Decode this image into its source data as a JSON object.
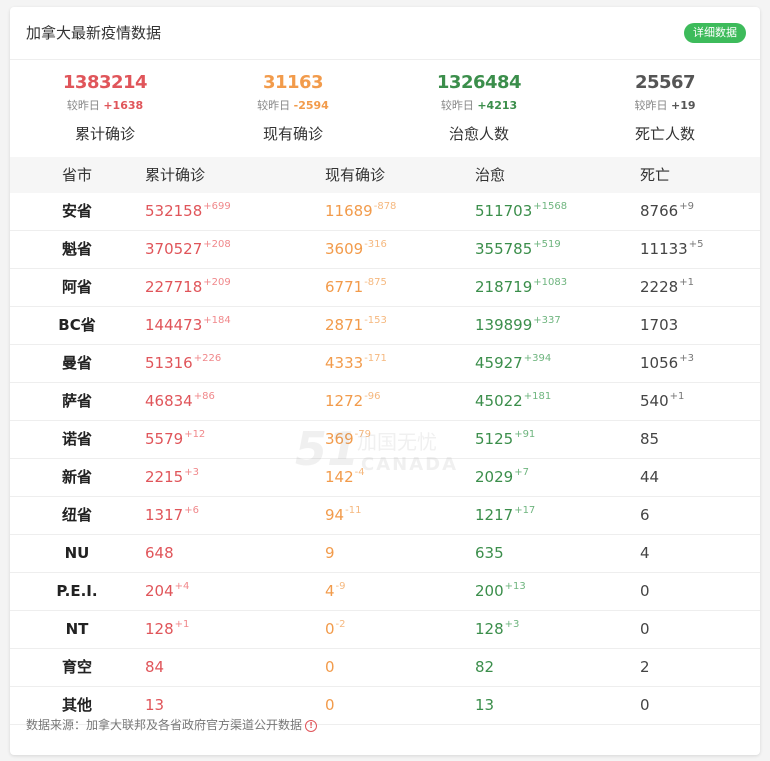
{
  "header": {
    "title": "加拿大最新疫情数据",
    "detail_label": "详细数据"
  },
  "summary": [
    {
      "value": "1383214",
      "delta_prefix": "较昨日",
      "delta": "+1638",
      "label": "累计确诊",
      "color": "#e0555a"
    },
    {
      "value": "31163",
      "delta_prefix": "较昨日",
      "delta": "-2594",
      "label": "现有确诊",
      "color": "#f29b4b"
    },
    {
      "value": "1326484",
      "delta_prefix": "较昨日",
      "delta": "+4213",
      "label": "治愈人数",
      "color": "#3b8e4b"
    },
    {
      "value": "25567",
      "delta_prefix": "较昨日",
      "delta": "+19",
      "label": "死亡人数",
      "color": "#555555"
    }
  ],
  "table": {
    "headers": [
      "省市",
      "累计确诊",
      "现有确诊",
      "治愈",
      "死亡"
    ],
    "rows": [
      {
        "province": "安省",
        "total": "532158",
        "total_d": "+699",
        "active": "11689",
        "active_d": "-878",
        "cured": "511703",
        "cured_d": "+1568",
        "dead": "8766",
        "dead_d": "+9"
      },
      {
        "province": "魁省",
        "total": "370527",
        "total_d": "+208",
        "active": "3609",
        "active_d": "-316",
        "cured": "355785",
        "cured_d": "+519",
        "dead": "11133",
        "dead_d": "+5"
      },
      {
        "province": "阿省",
        "total": "227718",
        "total_d": "+209",
        "active": "6771",
        "active_d": "-875",
        "cured": "218719",
        "cured_d": "+1083",
        "dead": "2228",
        "dead_d": "+1"
      },
      {
        "province": "BC省",
        "total": "144473",
        "total_d": "+184",
        "active": "2871",
        "active_d": "-153",
        "cured": "139899",
        "cured_d": "+337",
        "dead": "1703",
        "dead_d": ""
      },
      {
        "province": "曼省",
        "total": "51316",
        "total_d": "+226",
        "active": "4333",
        "active_d": "-171",
        "cured": "45927",
        "cured_d": "+394",
        "dead": "1056",
        "dead_d": "+3"
      },
      {
        "province": "萨省",
        "total": "46834",
        "total_d": "+86",
        "active": "1272",
        "active_d": "-96",
        "cured": "45022",
        "cured_d": "+181",
        "dead": "540",
        "dead_d": "+1"
      },
      {
        "province": "诺省",
        "total": "5579",
        "total_d": "+12",
        "active": "369",
        "active_d": "-79",
        "cured": "5125",
        "cured_d": "+91",
        "dead": "85",
        "dead_d": ""
      },
      {
        "province": "新省",
        "total": "2215",
        "total_d": "+3",
        "active": "142",
        "active_d": "-4",
        "cured": "2029",
        "cured_d": "+7",
        "dead": "44",
        "dead_d": ""
      },
      {
        "province": "纽省",
        "total": "1317",
        "total_d": "+6",
        "active": "94",
        "active_d": "-11",
        "cured": "1217",
        "cured_d": "+17",
        "dead": "6",
        "dead_d": ""
      },
      {
        "province": "NU",
        "total": "648",
        "total_d": "",
        "active": "9",
        "active_d": "",
        "cured": "635",
        "cured_d": "",
        "dead": "4",
        "dead_d": ""
      },
      {
        "province": "P.E.I.",
        "total": "204",
        "total_d": "+4",
        "active": "4",
        "active_d": "-9",
        "cured": "200",
        "cured_d": "+13",
        "dead": "0",
        "dead_d": ""
      },
      {
        "province": "NT",
        "total": "128",
        "total_d": "+1",
        "active": "0",
        "active_d": "-2",
        "cured": "128",
        "cured_d": "+3",
        "dead": "0",
        "dead_d": ""
      },
      {
        "province": "育空",
        "total": "84",
        "total_d": "",
        "active": "0",
        "active_d": "",
        "cured": "82",
        "cured_d": "",
        "dead": "2",
        "dead_d": ""
      },
      {
        "province": "其他",
        "total": "13",
        "total_d": "",
        "active": "0",
        "active_d": "",
        "cured": "13",
        "cured_d": "",
        "dead": "0",
        "dead_d": ""
      }
    ]
  },
  "watermark": {
    "number": "51",
    "cn": "加国无忧",
    "en": "CANADA"
  },
  "footer": {
    "text": "数据来源：加拿大联邦及各省政府官方渠道公开数据",
    "icon": "info-icon"
  }
}
